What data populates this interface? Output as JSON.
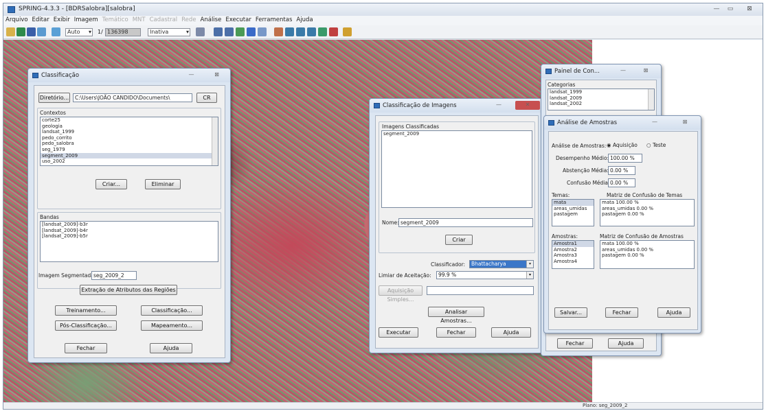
{
  "app": {
    "title": "SPRING-4.3.3 - [BDRSalobra][salobra]",
    "window_controls": [
      "—",
      "▭",
      "⊠"
    ]
  },
  "menu": [
    "Arquivo",
    "Editar",
    "Exibir",
    "Imagem",
    "Temático",
    "MNT",
    "Cadastral",
    "Rede",
    "Análise",
    "Executar",
    "Ferramentas",
    "Ajuda"
  ],
  "menu_disabled": [
    4,
    5,
    6,
    7
  ],
  "toolbar": {
    "mode": "Auto",
    "scale_prefix": "1/",
    "scale": "136398",
    "state": "Inativa"
  },
  "status": {
    "right_text": "Plano: seg_2009_2"
  },
  "classificacao": {
    "title": "Classificação",
    "diretorio_btn": "Diretório...",
    "diretorio_path": "C:\\Users\\JOÃO CANDIDO\\Documents\\",
    "cr_btn": "CR",
    "contextos_label": "Contextos",
    "contextos": [
      "corte25",
      "geologia",
      "landsat_1999",
      "pedo_corrito",
      "pedo_salobra",
      "seg_1979",
      "segment_2009",
      "uso_2002"
    ],
    "criar_btn": "Criar...",
    "eliminar_btn": "Eliminar",
    "bandas_label": "Bandas",
    "bandas": [
      "[landsat_2009]-b3r",
      "[landsat_2009]-b4r",
      "[landsat_2009]-b5r"
    ],
    "imagem_segmentada_label": "Imagem Segmentada:",
    "imagem_segmentada": "seg_2009_2",
    "extracao_btn": "Extração de Atributos das Regiões",
    "treinamento_btn": "Treinamento...",
    "classificacao_btn": "Classificação...",
    "pos_classificacao_btn": "Pós-Classificação...",
    "mapeamento_btn": "Mapeamento...",
    "fechar_btn": "Fechar",
    "ajuda_btn": "Ajuda"
  },
  "classificacao_imagens": {
    "title": "Classificação de Imagens",
    "imagens_label": "Imagens Classificadas",
    "imagens": [
      "segment_2009"
    ],
    "nome_label": "Nome:",
    "nome": "segment_2009",
    "criar_btn": "Criar",
    "classificador_label": "Classificador:",
    "classificador": "Bhattacharya",
    "limiar_label": "Limiar de Aceitação:",
    "limiar": "99.9 %",
    "aquisicao_btn": "Aquisição Simples...",
    "analisar_btn": "Analisar Amostras...",
    "executar_btn": "Executar",
    "fechar_btn": "Fechar",
    "ajuda_btn": "Ajuda"
  },
  "painel": {
    "title": "Painel de Con...",
    "categorias_label": "Categorias",
    "categorias": [
      "landsat_1999",
      "landsat_2009",
      "landsat_2002"
    ],
    "fechar_btn": "Fechar",
    "ajuda_btn": "Ajuda"
  },
  "analise": {
    "title": "Análise de Amostras",
    "analise_label": "Análise de Amostras:",
    "radio_aquisicao": "Aquisição",
    "radio_teste": "Teste",
    "desempenho_label": "Desempenho Médio:",
    "desempenho": "100.00 %",
    "abstencao_label": "Abstenção Média:",
    "abstencao": "0.00 %",
    "confusao_label": "Confusão Média:",
    "confusao": "0.00 %",
    "temas_label": "Temas:",
    "temas": [
      "mata",
      "areas_umidas",
      "pastagem"
    ],
    "matriz_temas_label": "Matriz de Confusão de Temas",
    "matriz_temas": [
      "mata 100.00 %",
      "areas_umidas 0.00 %",
      "pastagem 0.00 %"
    ],
    "amostras_label": "Amostras:",
    "amostras": [
      "Amostra1",
      "Amostra2",
      "Amostra3",
      "Amostra4"
    ],
    "matriz_amostras_label": "Matriz de Confusão de Amostras",
    "matriz_amostras": [
      "mata 100.00 %",
      "areas_umidas 0.00 %",
      "pastagem 0.00 %"
    ],
    "salvar_btn": "Salvar...",
    "fechar_btn": "Fechar",
    "ajuda_btn": "Ajuda"
  }
}
